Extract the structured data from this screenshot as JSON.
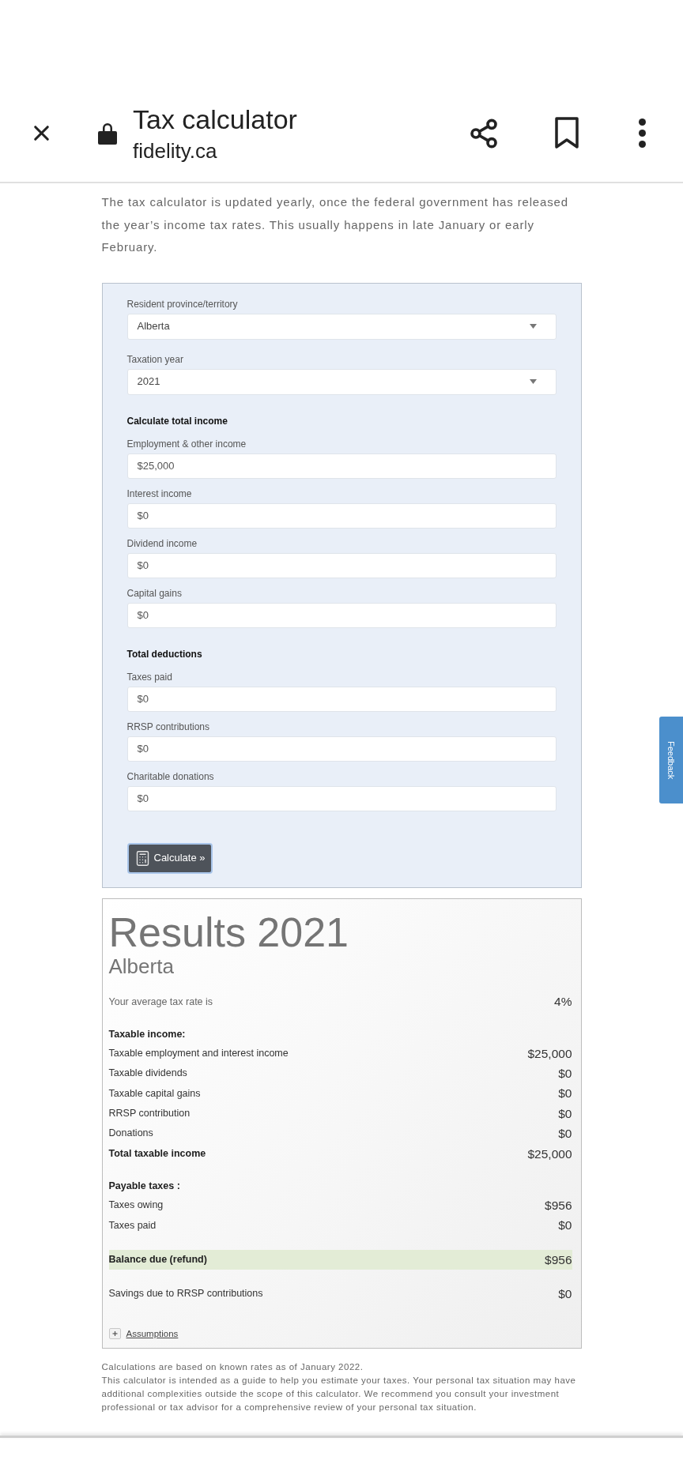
{
  "toolbar": {
    "title": "Tax calculator",
    "url": "fidelity.ca"
  },
  "intro": "The tax calculator is updated yearly, once the federal government has released the year’s income tax rates. This usually happens in late January or early February.",
  "form": {
    "items": [
      {
        "kind": "select",
        "label": "Resident province/territory",
        "value": "Alberta"
      },
      {
        "kind": "select",
        "label": "Taxation year",
        "value": "2021"
      },
      {
        "kind": "heading",
        "text": "Calculate total income"
      },
      {
        "kind": "input",
        "label": "Employment & other income",
        "value": "$25,000"
      },
      {
        "kind": "input",
        "label": "Interest income",
        "value": "$0"
      },
      {
        "kind": "input",
        "label": "Dividend income",
        "value": "$0"
      },
      {
        "kind": "input",
        "label": "Capital gains",
        "value": "$0"
      },
      {
        "kind": "heading",
        "text": "Total deductions"
      },
      {
        "kind": "input",
        "label": "Taxes paid",
        "value": "$0"
      },
      {
        "kind": "input",
        "label": "RRSP contributions",
        "value": "$0"
      },
      {
        "kind": "input",
        "label": "Charitable donations",
        "value": "$0"
      }
    ],
    "button": {
      "label": "Calculate »"
    }
  },
  "results": {
    "title": "Results 2021",
    "region": "Alberta",
    "sections": [
      {
        "rows": [
          {
            "kind": "rate",
            "label": "Your average tax rate is",
            "value": "4%"
          }
        ]
      },
      {
        "heading": "Taxable income:",
        "rows": [
          {
            "kind": "item",
            "label": "Taxable employment and interest income",
            "value": "$25,000"
          },
          {
            "kind": "item",
            "label": "Taxable dividends",
            "value": "$0"
          },
          {
            "kind": "item",
            "label": "Taxable capital gains",
            "value": "$0"
          },
          {
            "kind": "item",
            "label": "RRSP contribution",
            "value": "$0"
          },
          {
            "kind": "item",
            "label": "Donations",
            "value": "$0"
          },
          {
            "kind": "total",
            "label": "Total taxable income",
            "value": "$25,000"
          }
        ]
      },
      {
        "heading": "Payable taxes :",
        "rows": [
          {
            "kind": "item",
            "label": "Taxes owing",
            "value": "$956"
          },
          {
            "kind": "item",
            "label": "Taxes paid",
            "value": "$0"
          }
        ]
      },
      {
        "rows": [
          {
            "kind": "balance",
            "label": "Balance due (refund)",
            "value": "$956"
          }
        ]
      },
      {
        "rows": [
          {
            "kind": "item",
            "label": "Savings due to RRSP contributions",
            "value": "$0"
          }
        ]
      }
    ],
    "assumptions": {
      "label": "Assumptions",
      "expanded": false
    }
  },
  "footnotes": [
    "Calculations are based on known rates as of January 2022.",
    "This calculator is intended as a guide to help you estimate your taxes. Your personal tax situation may have additional complexities outside the scope of this calculator. We recommend you consult your investment professional or tax advisor for a comprehensive review of your personal tax situation."
  ],
  "feedback_tab": {
    "label": "Feedback"
  }
}
